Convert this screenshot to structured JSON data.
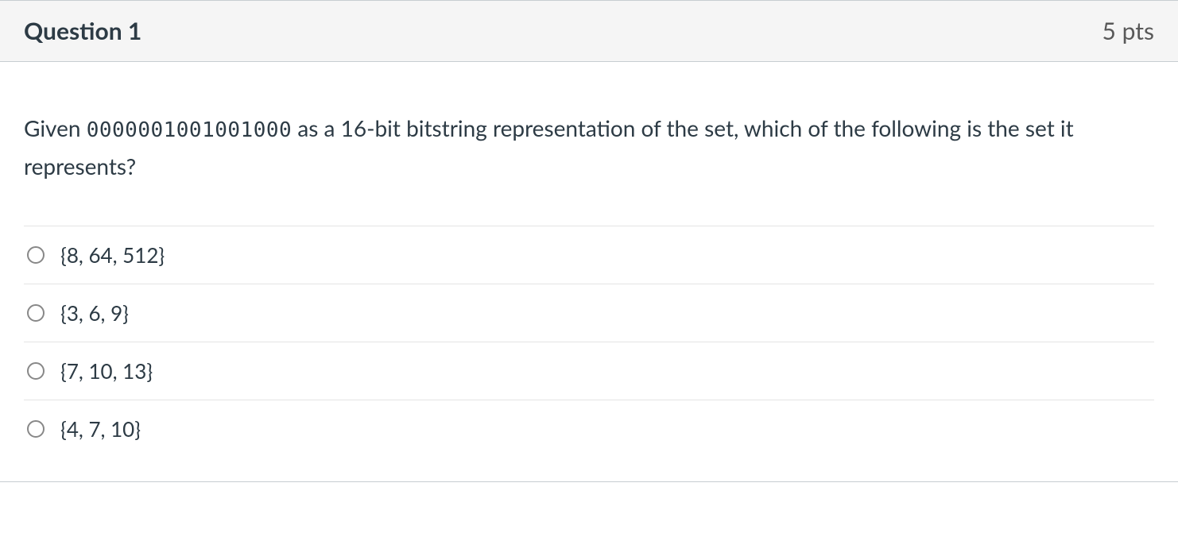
{
  "question": {
    "title": "Question 1",
    "points": "5 pts",
    "text_before": "Given ",
    "bitstring": "0000001001001000",
    "text_after": " as a 16-bit bitstring representation of the set, which of the following is the set it represents?",
    "answers": [
      {
        "label": "{8, 64, 512}"
      },
      {
        "label": "{3, 6, 9}"
      },
      {
        "label": "{7, 10, 13}"
      },
      {
        "label": "{4, 7, 10}"
      }
    ]
  }
}
